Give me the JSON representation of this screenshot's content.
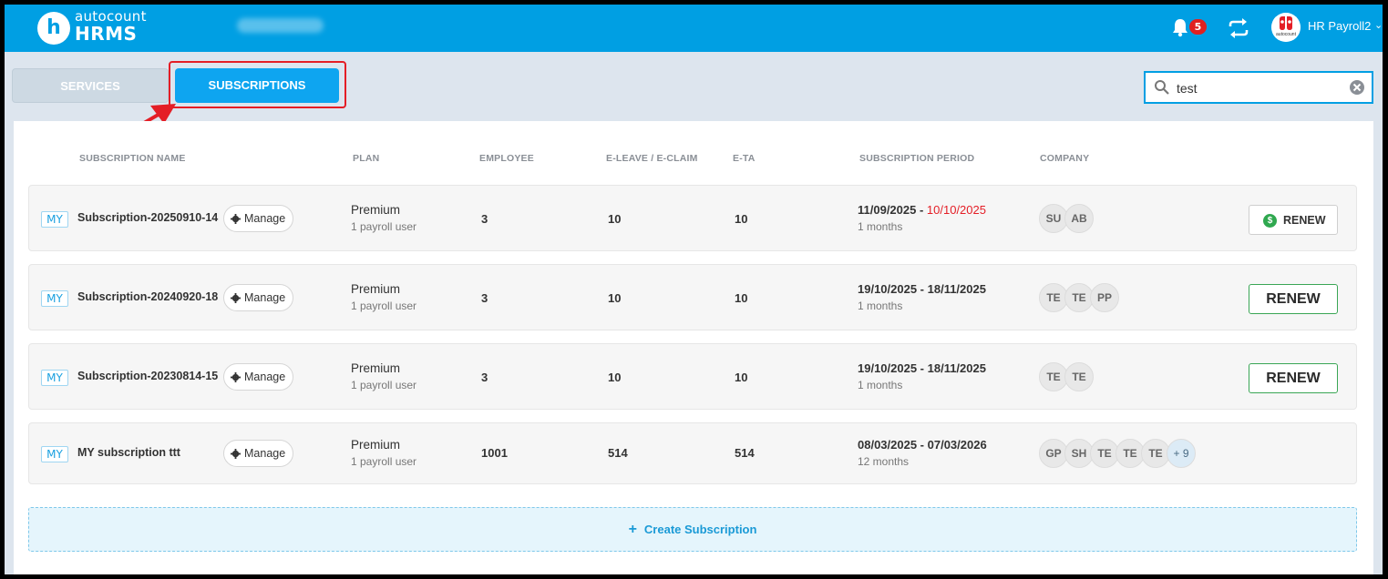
{
  "header": {
    "logo_letter": "h",
    "logo_top": "autocount",
    "logo_bottom": "HRMS",
    "notification_count": "5",
    "user_name": "HR Payroll2",
    "avatar_text": "autocount",
    "icons": [
      "bell-icon",
      "sync-icon",
      "chevron-down-icon"
    ]
  },
  "tabs": {
    "services": "SERVICES",
    "subscriptions": "SUBSCRIPTIONS",
    "active": "SUBSCRIPTIONS"
  },
  "search": {
    "value": "test",
    "placeholder": ""
  },
  "columns": {
    "name": "SUBSCRIPTION NAME",
    "plan": "PLAN",
    "employee": "EMPLOYEE",
    "leave_claim": "E-LEAVE / E-CLAIM",
    "eta": "E-TA",
    "period": "SUBSCRIPTION PERIOD",
    "company": "COMPANY"
  },
  "rows": [
    {
      "country": "MY",
      "name": "Subscription-20250910-14",
      "manage": "Manage",
      "plan": "Premium",
      "plan_sub": "1 payroll user",
      "employee": "3",
      "leave_claim": "10",
      "eta": "10",
      "period_start": "11/09/2025 - ",
      "period_end": "10/10/2025",
      "period_sub": "1 months",
      "companies": [
        "SU",
        "AB"
      ],
      "renew": "RENEW",
      "renew_symbol": "$"
    },
    {
      "country": "MY",
      "name": "Subscription-20240920-18",
      "manage": "Manage",
      "plan": "Premium",
      "plan_sub": "1 payroll user",
      "employee": "3",
      "leave_claim": "10",
      "eta": "10",
      "period": "19/10/2025 - 18/11/2025",
      "period_sub": "1 months",
      "companies": [
        "TE",
        "TE",
        "PP"
      ],
      "renew": "RENEW"
    },
    {
      "country": "MY",
      "name": "Subscription-20230814-15",
      "manage": "Manage",
      "plan": "Premium",
      "plan_sub": "1 payroll user",
      "employee": "3",
      "leave_claim": "10",
      "eta": "10",
      "period": "19/10/2025 - 18/11/2025",
      "period_sub": "1 months",
      "companies": [
        "TE",
        "TE"
      ],
      "renew": "RENEW"
    },
    {
      "country": "MY",
      "name": "MY subscription ttt",
      "manage": "Manage",
      "plan": "Premium",
      "plan_sub": "1 payroll user",
      "employee": "1001",
      "leave_claim": "514",
      "eta": "514",
      "period": "08/03/2025 - 07/03/2026",
      "period_sub": "12 months",
      "companies": [
        "GP",
        "SH",
        "TE",
        "TE",
        "TE"
      ],
      "companies_more": "+ 9"
    }
  ],
  "create_label": "Create Subscription",
  "colors": {
    "primary": "#009fe3",
    "tab_active": "#0ea5f0",
    "highlight": "#e41e26",
    "renew_border": "#3aa655",
    "expiry": "#e41e26"
  }
}
